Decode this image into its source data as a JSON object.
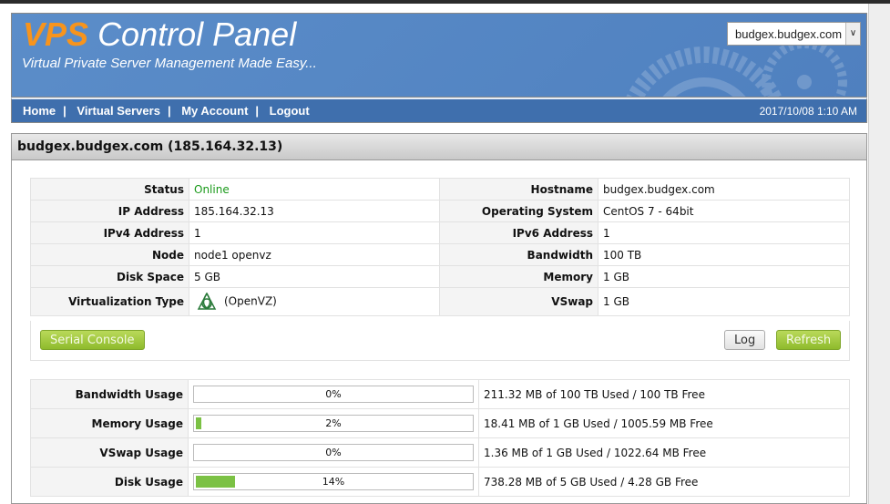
{
  "header": {
    "title_accent": "VPS",
    "title_rest": "Control Panel",
    "tagline": "Virtual Private Server Management Made Easy...",
    "server_select": "budgex.budgex.com"
  },
  "nav": {
    "items": [
      "Home",
      "Virtual Servers",
      "My Account",
      "Logout"
    ],
    "datetime": "2017/10/08 1:10 AM"
  },
  "panel": {
    "title": "budgex.budgex.com (185.164.32.13)"
  },
  "info": [
    {
      "l1": "Status",
      "v1": "Online",
      "l2": "Hostname",
      "v2": "budgex.budgex.com"
    },
    {
      "l1": "IP Address",
      "v1": "185.164.32.13",
      "l2": "Operating System",
      "v2": "CentOS 7 - 64bit"
    },
    {
      "l1": "IPv4 Address",
      "v1": "1",
      "l2": "IPv6 Address",
      "v2": "1"
    },
    {
      "l1": "Node",
      "v1": "node1 openvz",
      "l2": "Bandwidth",
      "v2": "100 TB"
    },
    {
      "l1": "Disk Space",
      "v1": "5 GB",
      "l2": "Memory",
      "v2": "1 GB"
    },
    {
      "l1": "Virtualization Type",
      "v1": "(OpenVZ)",
      "l2": "VSwap",
      "v2": "1 GB"
    }
  ],
  "status_color": "#1a9a1a",
  "buttons": {
    "serial": "Serial Console",
    "log": "Log",
    "refresh": "Refresh"
  },
  "usage": [
    {
      "label": "Bandwidth Usage",
      "percent": 0,
      "pct_label": "0%",
      "detail": "211.32 MB of 100 TB Used / 100 TB Free"
    },
    {
      "label": "Memory Usage",
      "percent": 2,
      "pct_label": "2%",
      "detail": "18.41 MB of 1 GB Used / 1005.59 MB Free"
    },
    {
      "label": "VSwap Usage",
      "percent": 0,
      "pct_label": "0%",
      "detail": "1.36 MB of 1 GB Used / 1022.64 MB Free"
    },
    {
      "label": "Disk Usage",
      "percent": 14,
      "pct_label": "14%",
      "detail": "738.28 MB of 5 GB Used / 4.28 GB Free"
    }
  ]
}
